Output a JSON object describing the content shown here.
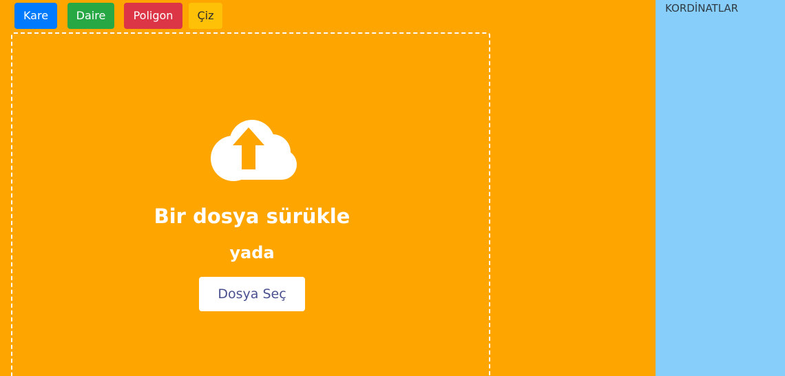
{
  "toolbar": {
    "buttons": [
      {
        "label": "Kare",
        "color": "#007bff"
      },
      {
        "label": "Daire",
        "color": "#28a745"
      },
      {
        "label": "Poligon",
        "color": "#dc3545"
      },
      {
        "label": "Çiz",
        "color": "#ffc107"
      }
    ]
  },
  "upload": {
    "icon": "cloud-upload-icon",
    "title": "Bir dosya sürükle",
    "or_text": "yada",
    "button_label": "Dosya Seç"
  },
  "sidebar": {
    "title": "KORDİNATLAR"
  },
  "colors": {
    "main_background": "#ffa500",
    "sidebar_background": "#87cefa",
    "choose_button_text": "#4a4f8f"
  }
}
